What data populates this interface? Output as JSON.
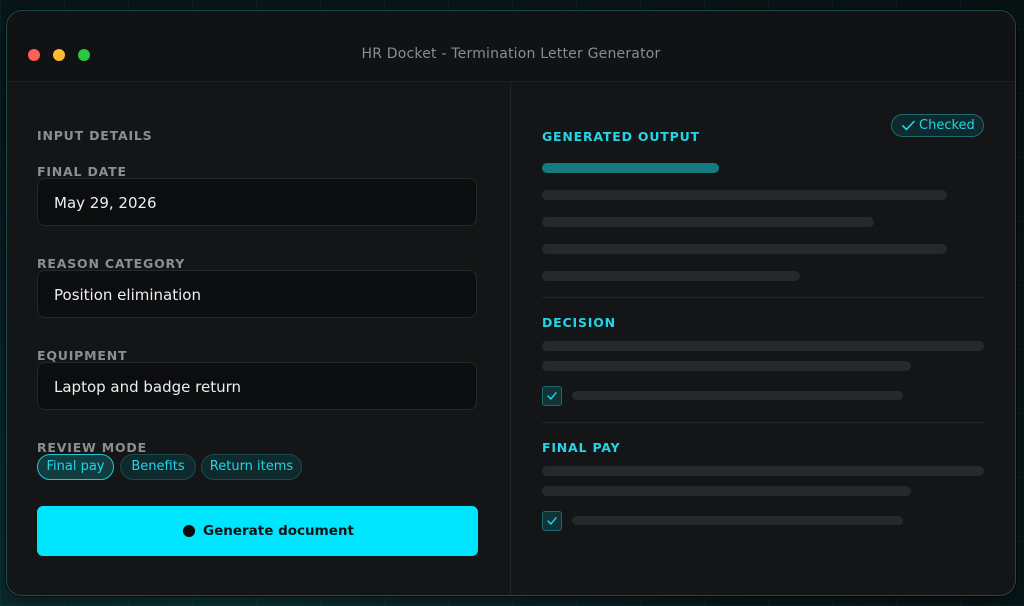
{
  "window": {
    "title": "HR Docket - Termination Letter Generator"
  },
  "input": {
    "section_label": "INPUT DETAILS",
    "final_date": {
      "label": "FINAL DATE",
      "value": "May 29, 2026"
    },
    "reason_category": {
      "label": "REASON CATEGORY",
      "value": "Position elimination"
    },
    "equipment": {
      "label": "EQUIPMENT",
      "value": "Laptop and badge return"
    },
    "review_mode": {
      "label": "REVIEW MODE",
      "options": [
        "Final pay",
        "Benefits",
        "Return items"
      ],
      "selected": "Final pay"
    },
    "generate_label": "Generate document"
  },
  "output": {
    "section_label": "GENERATED OUTPUT",
    "badge_label": "Checked",
    "decision_label": "DECISION",
    "final_pay_label": "FINAL PAY"
  },
  "colors": {
    "accent": "#00e5ff",
    "accent_text": "#22d6e8",
    "window_bg": "#141516",
    "field_bg": "#0c0d0e"
  },
  "icons": [
    "check-icon"
  ]
}
